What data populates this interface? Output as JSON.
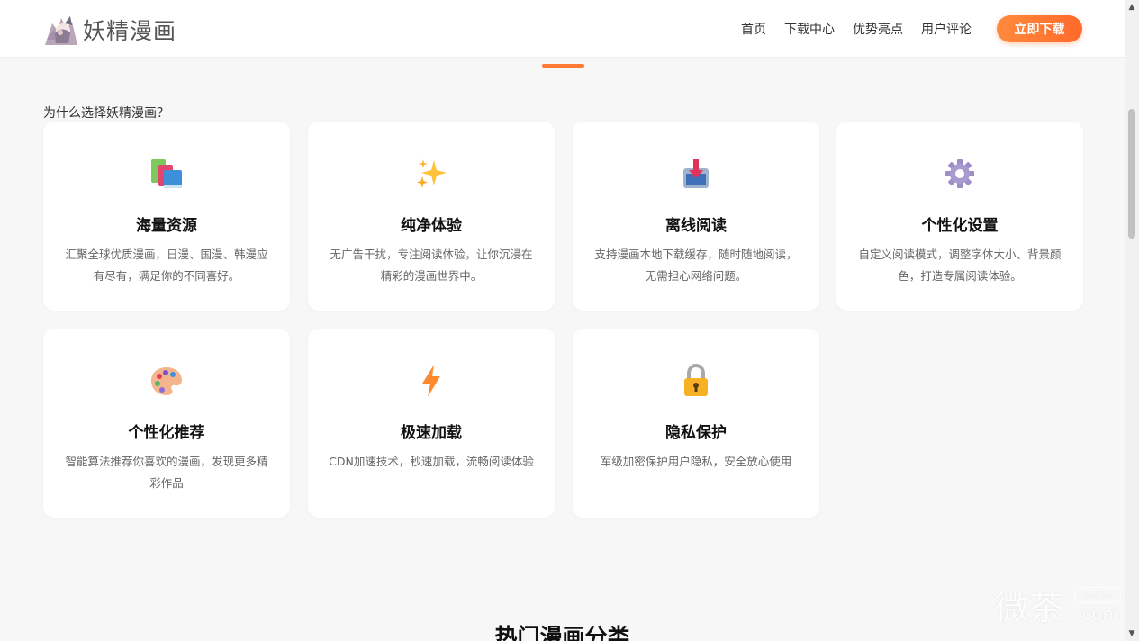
{
  "header": {
    "logo_text": "妖精漫画",
    "nav": [
      "首页",
      "下载中心",
      "优势亮点",
      "用户评论"
    ],
    "download_label": "立即下载"
  },
  "section": {
    "title": "为什么选择妖精漫画？"
  },
  "features": [
    {
      "icon": "books-icon",
      "title": "海量资源",
      "desc": "汇聚全球优质漫画，日漫、国漫、韩漫应有尽有，满足你的不同喜好。"
    },
    {
      "icon": "sparkles-icon",
      "title": "纯净体验",
      "desc": "无广告干扰，专注阅读体验，让你沉浸在精彩的漫画世界中。"
    },
    {
      "icon": "download-inbox-icon",
      "title": "离线阅读",
      "desc": "支持漫画本地下载缓存，随时随地阅读，无需担心网络问题。"
    },
    {
      "icon": "gear-icon",
      "title": "个性化设置",
      "desc": "自定义阅读模式，调整字体大小、背景颜色，打造专属阅读体验。"
    },
    {
      "icon": "palette-icon",
      "title": "个性化推荐",
      "desc": "智能算法推荐你喜欢的漫画，发现更多精彩作品"
    },
    {
      "icon": "lightning-icon",
      "title": "极速加载",
      "desc": "CDN加速技术，秒速加载，流畅阅读体验"
    },
    {
      "icon": "lock-icon",
      "title": "隐私保护",
      "desc": "军级加密保护用户隐私，安全放心使用"
    }
  ],
  "next_section": {
    "title": "热门漫画分类"
  },
  "watermark": {
    "text": "微茶",
    "badge": "WXCHA",
    "domain": ".com"
  },
  "colors": {
    "accent": "#ff7a35",
    "background": "#f7f7f8"
  }
}
